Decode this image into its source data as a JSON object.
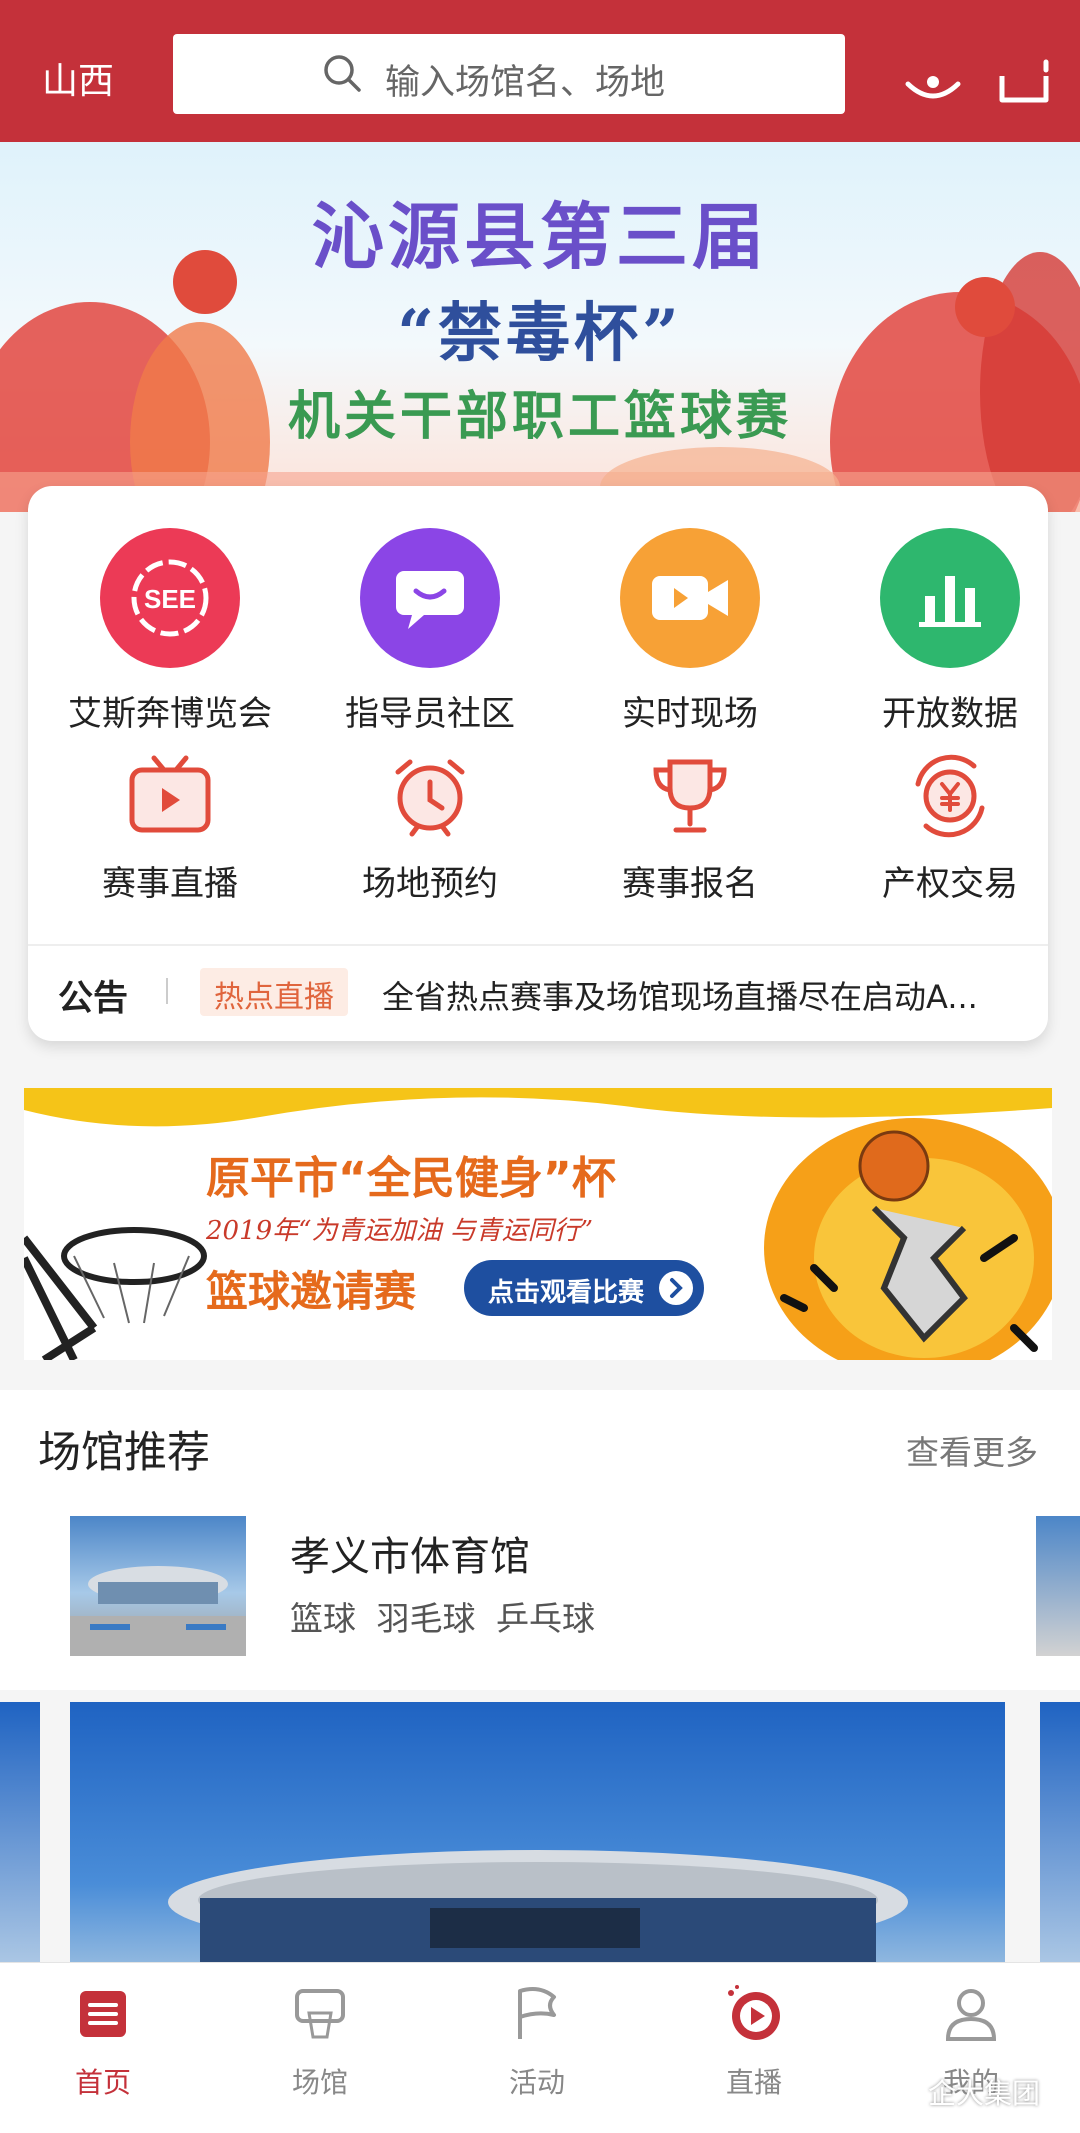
{
  "header": {
    "city": "山西",
    "search_placeholder": "输入场馆名、场地"
  },
  "banner1": {
    "line1": "沁源县第三届",
    "line2": "“禁毒杯”",
    "line3": "机关干部职工篮球赛"
  },
  "quick_grid": [
    {
      "label": "艾斯奔博览会",
      "icon": "see-icon",
      "color": "#ec3a56"
    },
    {
      "label": "指导员社区",
      "icon": "chat-icon",
      "color": "#8b45e6"
    },
    {
      "label": "实时现场",
      "icon": "video-camera-icon",
      "color": "#f7a136"
    },
    {
      "label": "开放数据",
      "icon": "bar-chart-icon",
      "color": "#2eb76e"
    }
  ],
  "quick_grid2": [
    {
      "label": "赛事直播",
      "icon": "tv-icon"
    },
    {
      "label": "场地预约",
      "icon": "alarm-clock-icon"
    },
    {
      "label": "赛事报名",
      "icon": "trophy-icon"
    },
    {
      "label": "产权交易",
      "icon": "yuan-exchange-icon"
    }
  ],
  "notice": {
    "label": "公告",
    "tag": "热点直播",
    "text": "全省热点赛事及场馆现场直播尽在启动A..."
  },
  "banner2": {
    "title": "原平市“全民健身”杯",
    "slogan": "2019年“为青运加油 与青运同行”",
    "subtitle": "篮球邀请赛",
    "button": "点击观看比赛"
  },
  "venues_section": {
    "title": "场馆推荐",
    "more": "查看更多"
  },
  "venue": {
    "name": "孝义市体育馆",
    "tags": "篮球 羽毛球 乒乓球"
  },
  "tabs": [
    {
      "label": "首页",
      "icon": "home-icon",
      "active": true
    },
    {
      "label": "场馆",
      "icon": "basketball-hoop-icon",
      "active": false
    },
    {
      "label": "活动",
      "icon": "flag-icon",
      "active": false
    },
    {
      "label": "直播",
      "icon": "play-icon",
      "active": false
    },
    {
      "label": "我的",
      "icon": "user-icon",
      "active": false
    }
  ],
  "watermark": "企大集团"
}
